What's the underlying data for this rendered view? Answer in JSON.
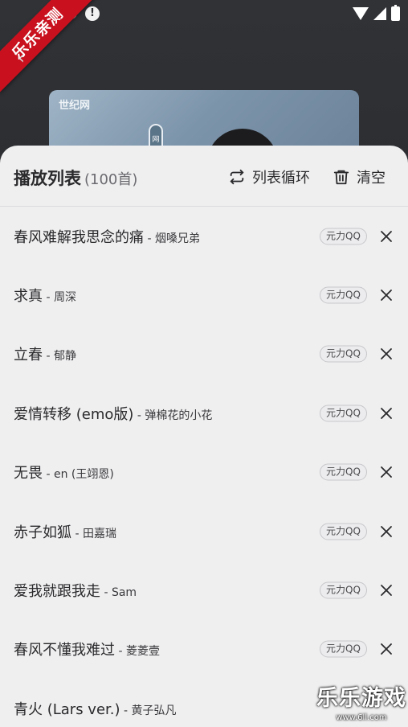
{
  "status_bar": {
    "icons": [
      "bug-icon",
      "alert-icon",
      "wifi-icon",
      "signal-icon",
      "battery-charging-icon"
    ]
  },
  "ribbon": {
    "text": "乐乐亲测"
  },
  "cover": {
    "logo_text": "世纪网",
    "pill_text": "网"
  },
  "playlist": {
    "title": "播放列表",
    "count": "(100首)",
    "loop_label": "列表循环",
    "clear_label": "清空",
    "songs": [
      {
        "title": "春风难解我思念的痛",
        "sep": " - ",
        "artist": "烟嗓兄弟",
        "source": "元力QQ"
      },
      {
        "title": "求真",
        "sep": " - ",
        "artist": "周深",
        "source": "元力QQ"
      },
      {
        "title": "立春",
        "sep": " - ",
        "artist": "郁静",
        "source": "元力QQ"
      },
      {
        "title": "爱情转移 (emo版)",
        "sep": " - ",
        "artist": "弹棉花的小花",
        "source": "元力QQ"
      },
      {
        "title": "无畏",
        "sep": " - ",
        "artist": "en (王翊恩)",
        "source": "元力QQ"
      },
      {
        "title": "赤子如狐",
        "sep": " - ",
        "artist": "田嘉瑞",
        "source": "元力QQ"
      },
      {
        "title": "爱我就跟我走",
        "sep": " - ",
        "artist": "Sam",
        "source": "元力QQ"
      },
      {
        "title": "春风不懂我难过",
        "sep": " - ",
        "artist": "菱菱壹",
        "source": "元力QQ"
      },
      {
        "title": "青火 (Lars ver.)",
        "sep": " - ",
        "artist": "黄子弘凡",
        "source": ""
      }
    ]
  },
  "watermark": {
    "main": "乐乐游戏",
    "url": "www.6ll.com"
  },
  "colors": {
    "sheet_bg": "#efeff0",
    "ribbon": "#c8101e",
    "text": "#2a2a2c"
  }
}
